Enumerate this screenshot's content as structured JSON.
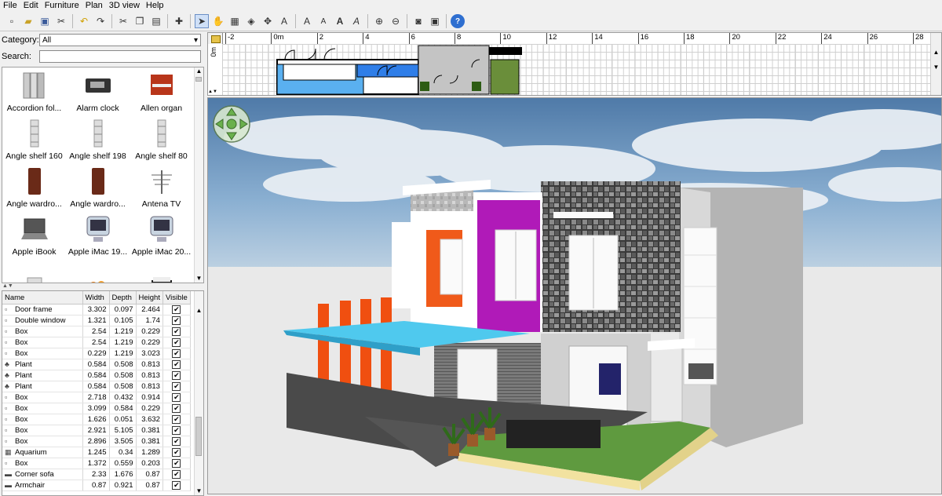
{
  "menu": [
    "File",
    "Edit",
    "Furniture",
    "Plan",
    "3D view",
    "Help"
  ],
  "toolbar": {
    "icons": [
      "new-file-icon",
      "open-folder-icon",
      "save-icon",
      "cut-scissors-icon",
      "undo-icon",
      "redo-icon",
      "cut-icon",
      "copy-icon",
      "paste-icon",
      "add-furniture-icon",
      "select-arrow-icon",
      "pan-hand-icon",
      "create-walls-icon",
      "create-rooms-icon",
      "create-dimensions-icon",
      "add-text-icon",
      "increase-text-icon",
      "decrease-text-icon",
      "bold-text-icon",
      "italic-text-icon",
      "zoom-in-icon",
      "zoom-out-icon",
      "create-photo-icon",
      "create-video-icon",
      "help-icon"
    ]
  },
  "catalog": {
    "category_label": "Category:",
    "category_value": "All",
    "search_label": "Search:",
    "search_value": "",
    "items": [
      {
        "label": "Accordion fol...",
        "icon": "accordion-door-icon"
      },
      {
        "label": "Alarm clock",
        "icon": "alarm-clock-icon"
      },
      {
        "label": "Allen organ",
        "icon": "organ-icon"
      },
      {
        "label": "Angle shelf 160",
        "icon": "angle-shelf-icon"
      },
      {
        "label": "Angle shelf 198",
        "icon": "angle-shelf-icon"
      },
      {
        "label": "Angle shelf 80",
        "icon": "angle-shelf-icon"
      },
      {
        "label": "Angle wardro...",
        "icon": "wardrobe-icon"
      },
      {
        "label": "Angle wardro...",
        "icon": "wardrobe-icon"
      },
      {
        "label": "Antena TV",
        "icon": "antenna-icon"
      },
      {
        "label": "Apple iBook",
        "icon": "laptop-icon"
      },
      {
        "label": "Apple iMac 19...",
        "icon": "imac-icon"
      },
      {
        "label": "Apple iMac 20...",
        "icon": "imac-icon"
      },
      {
        "label": "",
        "icon": "appliance-icon"
      },
      {
        "label": "",
        "icon": "fruit-bowl-icon"
      },
      {
        "label": "",
        "icon": "armchair-icon"
      }
    ]
  },
  "furniture_table": {
    "columns": [
      "Name",
      "Width",
      "Depth",
      "Height",
      "Visible"
    ],
    "rows": [
      {
        "name": "Door frame",
        "width": "3.302",
        "depth": "0.097",
        "height": "2.464",
        "visible": true
      },
      {
        "name": "Double window",
        "width": "1.321",
        "depth": "0.105",
        "height": "1.74",
        "visible": true
      },
      {
        "name": "Box",
        "width": "2.54",
        "depth": "1.219",
        "height": "0.229",
        "visible": true
      },
      {
        "name": "Box",
        "width": "2.54",
        "depth": "1.219",
        "height": "0.229",
        "visible": true
      },
      {
        "name": "Box",
        "width": "0.229",
        "depth": "1.219",
        "height": "3.023",
        "visible": true
      },
      {
        "name": "Plant",
        "width": "0.584",
        "depth": "0.508",
        "height": "0.813",
        "visible": true
      },
      {
        "name": "Plant",
        "width": "0.584",
        "depth": "0.508",
        "height": "0.813",
        "visible": true
      },
      {
        "name": "Plant",
        "width": "0.584",
        "depth": "0.508",
        "height": "0.813",
        "visible": true
      },
      {
        "name": "Box",
        "width": "2.718",
        "depth": "0.432",
        "height": "0.914",
        "visible": true
      },
      {
        "name": "Box",
        "width": "3.099",
        "depth": "0.584",
        "height": "0.229",
        "visible": true
      },
      {
        "name": "Box",
        "width": "1.626",
        "depth": "0.051",
        "height": "3.632",
        "visible": true
      },
      {
        "name": "Box",
        "width": "2.921",
        "depth": "5.105",
        "height": "0.381",
        "visible": true
      },
      {
        "name": "Box",
        "width": "2.896",
        "depth": "3.505",
        "height": "0.381",
        "visible": true
      },
      {
        "name": "Aquarium",
        "width": "1.245",
        "depth": "0.34",
        "height": "1.289",
        "visible": true
      },
      {
        "name": "Box",
        "width": "1.372",
        "depth": "0.559",
        "height": "0.203",
        "visible": true
      },
      {
        "name": "Corner sofa",
        "width": "2.33",
        "depth": "1.676",
        "height": "0.87",
        "visible": true
      },
      {
        "name": "Armchair",
        "width": "0.87",
        "depth": "0.921",
        "height": "0.87",
        "visible": true
      }
    ]
  },
  "plan": {
    "ruler_labels": [
      "-2",
      "0m",
      "2",
      "4",
      "6",
      "8",
      "10",
      "12",
      "14",
      "16",
      "18",
      "20",
      "22",
      "24",
      "26",
      "28"
    ],
    "left_ruler_label": "0m"
  },
  "view3d": {
    "sky_color": "#5f88b4",
    "accent_colors": {
      "orange": "#f05a1a",
      "purple": "#b01ab8",
      "cyan": "#4fc9ee"
    }
  }
}
